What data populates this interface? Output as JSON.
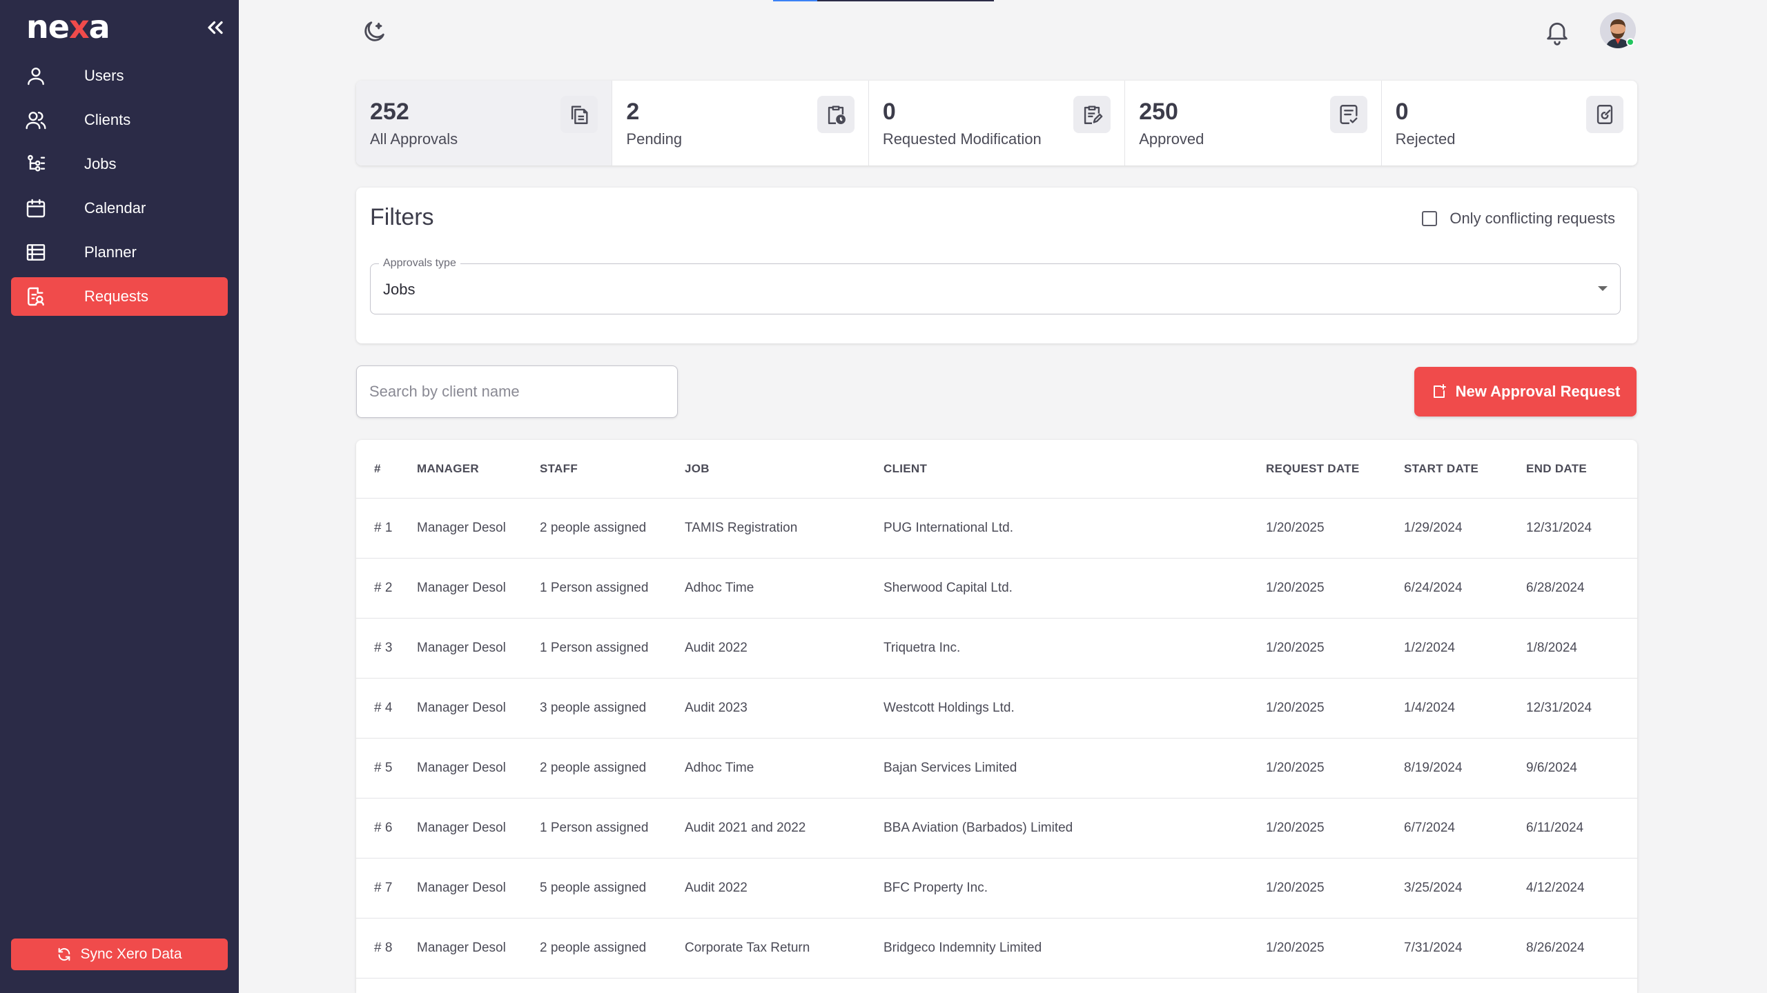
{
  "app": {
    "logo_prefix": "ne",
    "logo_x": "x",
    "logo_suffix": "a"
  },
  "sidebar": {
    "items": [
      {
        "label": "Users",
        "icon": "user-icon"
      },
      {
        "label": "Clients",
        "icon": "users-icon"
      },
      {
        "label": "Jobs",
        "icon": "jobs-icon"
      },
      {
        "label": "Calendar",
        "icon": "calendar-icon"
      },
      {
        "label": "Planner",
        "icon": "planner-icon"
      },
      {
        "label": "Requests",
        "icon": "requests-icon",
        "active": true
      }
    ],
    "sync_label": "Sync Xero Data"
  },
  "stats": [
    {
      "value": "252",
      "label": "All Approvals",
      "icon": "documents-icon",
      "active": true
    },
    {
      "value": "2",
      "label": "Pending",
      "icon": "clipboard-clock-icon"
    },
    {
      "value": "0",
      "label": "Requested Modification",
      "icon": "clipboard-edit-icon"
    },
    {
      "value": "250",
      "label": "Approved",
      "icon": "list-check-icon"
    },
    {
      "value": "0",
      "label": "Rejected",
      "icon": "document-edit-icon"
    }
  ],
  "filters": {
    "title": "Filters",
    "conflicting_label": "Only conflicting requests",
    "approvals_type_label": "Approvals type",
    "approvals_type_value": "Jobs"
  },
  "search": {
    "placeholder": "Search by client name"
  },
  "new_request_label": "New Approval Request",
  "table": {
    "columns": [
      "#",
      "Manager",
      "Staff",
      "Job",
      "Client",
      "Request Date",
      "Start Date",
      "End Date"
    ],
    "rows": [
      [
        "# 1",
        "Manager Desol",
        "2 people assigned",
        "TAMIS Registration",
        "PUG International Ltd.",
        "1/20/2025",
        "1/29/2024",
        "12/31/2024"
      ],
      [
        "# 2",
        "Manager Desol",
        "1 Person assigned",
        "Adhoc Time",
        "Sherwood Capital Ltd.",
        "1/20/2025",
        "6/24/2024",
        "6/28/2024"
      ],
      [
        "# 3",
        "Manager Desol",
        "1 Person assigned",
        "Audit 2022",
        "Triquetra Inc.",
        "1/20/2025",
        "1/2/2024",
        "1/8/2024"
      ],
      [
        "# 4",
        "Manager Desol",
        "3 people assigned",
        "Audit 2023",
        "Westcott Holdings Ltd.",
        "1/20/2025",
        "1/4/2024",
        "12/31/2024"
      ],
      [
        "# 5",
        "Manager Desol",
        "2 people assigned",
        "Adhoc Time",
        "Bajan Services Limited",
        "1/20/2025",
        "8/19/2024",
        "9/6/2024"
      ],
      [
        "# 6",
        "Manager Desol",
        "1 Person assigned",
        "Audit 2021 and 2022",
        "BBA Aviation (Barbados) Limited",
        "1/20/2025",
        "6/7/2024",
        "6/11/2024"
      ],
      [
        "# 7",
        "Manager Desol",
        "5 people assigned",
        "Audit 2022",
        "BFC Property Inc.",
        "1/20/2025",
        "3/25/2024",
        "4/12/2024"
      ],
      [
        "# 8",
        "Manager Desol",
        "2 people assigned",
        "Corporate Tax Return",
        "Bridgeco Indemnity Limited",
        "1/20/2025",
        "7/31/2024",
        "8/26/2024"
      ]
    ]
  },
  "colors": {
    "sidebar_bg": "#2b2b47",
    "accent": "#f04b4b",
    "online": "#22c55e",
    "page_bg": "#f4f4f5"
  }
}
